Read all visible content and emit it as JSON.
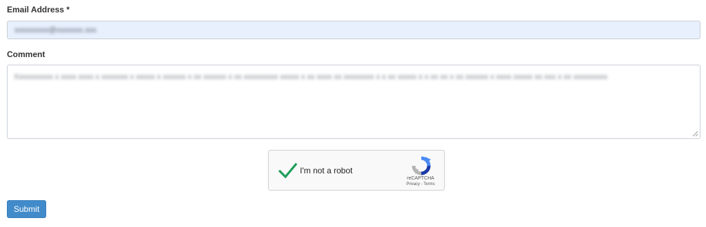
{
  "form": {
    "email_label": "Email Address *",
    "email_value": "xxxxxxxxx@xxxxxxx.xxx",
    "comment_label": "Comment",
    "comment_value": "Xxxxxxxxxx x xxxx xxxx x xxxxxxx x xxxxx x xxxxxx x xx xxxxxx x xx xxxxxxxxx xxxxx x xx xxxx xx xxxxxxxx x x xx xxxxx x x xx xx x xx xxxxxx x xxxx xxxxx xx xxx x xx xxxxxxxxx",
    "submit_label": "Submit"
  },
  "recaptcha": {
    "label": "I'm not a robot",
    "brand": "reCAPTCHA",
    "privacy_label": "Privacy",
    "separator": " - ",
    "terms_label": "Terms",
    "checked": true,
    "check_color": "#1e9e5a"
  },
  "colors": {
    "input_autofill_bg": "#e8f0fe",
    "button_bg": "#428bca",
    "text": "#333333"
  },
  "icons": {
    "checkmark": "checkmark-icon",
    "recaptcha_logo": "recaptcha-logo-icon",
    "resize": "resize-handle-icon"
  }
}
